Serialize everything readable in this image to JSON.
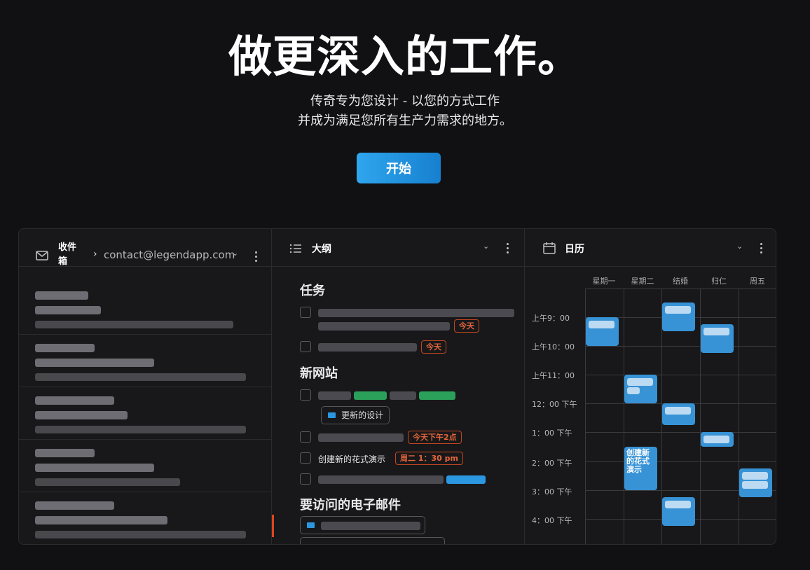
{
  "hero": {
    "title": "做更深入的工作。",
    "subtitle_line1": "传奇专为您设计 - 以您的方式工作",
    "subtitle_line2": "并成为满足您所有生产力需求的地方。",
    "cta": "开始"
  },
  "inbox": {
    "title": "收件箱",
    "arrow": "›",
    "email": "contact@legendapp.com",
    "caret": "⌄"
  },
  "outline": {
    "title": "大纲",
    "caret": "⌄",
    "sections": {
      "tasks": "任务",
      "new_site": "新网站",
      "emails": "要访问的电子邮件"
    },
    "tags": {
      "today1": "今天",
      "today2": "今天",
      "today_2pm": "今天下午2点",
      "tue": "周二 1：30 pm"
    },
    "chip_update_design": "更新的设计",
    "task_create_demo": "创建新的花式演示"
  },
  "calendar": {
    "title": "日历",
    "caret": "⌄",
    "days": [
      "星期一",
      "星期二",
      "结婚",
      "归仁",
      "周五"
    ],
    "hours": [
      "上午9：00",
      "上午10：00",
      "上午11：00",
      "12：00 下午",
      "1：00 下午",
      "2：00 下午",
      "3：00 下午",
      "4：00 下午"
    ],
    "event_text": "创建新的花式演示"
  },
  "colors": {
    "accent": "#2b97e0",
    "tag_orange": "#e4653a",
    "event_blue": "#3793d6",
    "green": "#2aa05a"
  }
}
